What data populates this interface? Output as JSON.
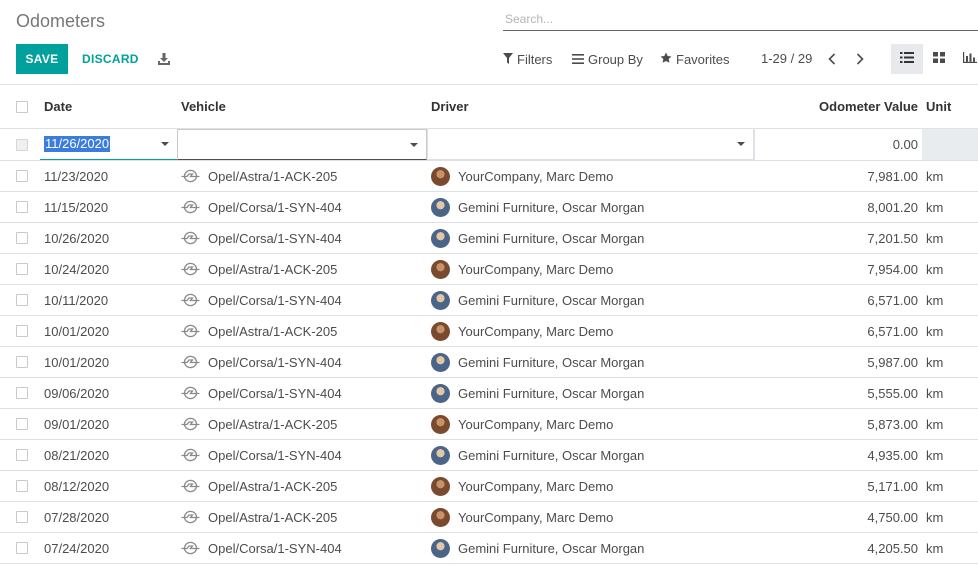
{
  "header": {
    "title": "Odometers",
    "search_placeholder": "Search..."
  },
  "toolbar": {
    "save_label": "SAVE",
    "discard_label": "DISCARD",
    "filters_label": "Filters",
    "groupby_label": "Group By",
    "favorites_label": "Favorites",
    "pager": "1-29 / 29"
  },
  "columns": {
    "date": "Date",
    "vehicle": "Vehicle",
    "driver": "Driver",
    "odometer": "Odometer Value",
    "unit": "Unit"
  },
  "edit_row": {
    "date": "11/26/2020",
    "vehicle": "",
    "driver": "",
    "odometer": "0.00"
  },
  "rows": [
    {
      "date": "11/23/2020",
      "vehicle": "Opel/Astra/1-ACK-205",
      "driver": "YourCompany, Marc Demo",
      "odometer": "7,981.00",
      "unit": "km",
      "avatar": "marc"
    },
    {
      "date": "11/15/2020",
      "vehicle": "Opel/Corsa/1-SYN-404",
      "driver": "Gemini Furniture, Oscar Morgan",
      "odometer": "8,001.20",
      "unit": "km",
      "avatar": "oscar"
    },
    {
      "date": "10/26/2020",
      "vehicle": "Opel/Corsa/1-SYN-404",
      "driver": "Gemini Furniture, Oscar Morgan",
      "odometer": "7,201.50",
      "unit": "km",
      "avatar": "oscar"
    },
    {
      "date": "10/24/2020",
      "vehicle": "Opel/Astra/1-ACK-205",
      "driver": "YourCompany, Marc Demo",
      "odometer": "7,954.00",
      "unit": "km",
      "avatar": "marc"
    },
    {
      "date": "10/11/2020",
      "vehicle": "Opel/Corsa/1-SYN-404",
      "driver": "Gemini Furniture, Oscar Morgan",
      "odometer": "6,571.00",
      "unit": "km",
      "avatar": "oscar"
    },
    {
      "date": "10/01/2020",
      "vehicle": "Opel/Astra/1-ACK-205",
      "driver": "YourCompany, Marc Demo",
      "odometer": "6,571.00",
      "unit": "km",
      "avatar": "marc"
    },
    {
      "date": "10/01/2020",
      "vehicle": "Opel/Corsa/1-SYN-404",
      "driver": "Gemini Furniture, Oscar Morgan",
      "odometer": "5,987.00",
      "unit": "km",
      "avatar": "oscar"
    },
    {
      "date": "09/06/2020",
      "vehicle": "Opel/Corsa/1-SYN-404",
      "driver": "Gemini Furniture, Oscar Morgan",
      "odometer": "5,555.00",
      "unit": "km",
      "avatar": "oscar"
    },
    {
      "date": "09/01/2020",
      "vehicle": "Opel/Astra/1-ACK-205",
      "driver": "YourCompany, Marc Demo",
      "odometer": "5,873.00",
      "unit": "km",
      "avatar": "marc"
    },
    {
      "date": "08/21/2020",
      "vehicle": "Opel/Corsa/1-SYN-404",
      "driver": "Gemini Furniture, Oscar Morgan",
      "odometer": "4,935.00",
      "unit": "km",
      "avatar": "oscar"
    },
    {
      "date": "08/12/2020",
      "vehicle": "Opel/Astra/1-ACK-205",
      "driver": "YourCompany, Marc Demo",
      "odometer": "5,171.00",
      "unit": "km",
      "avatar": "marc"
    },
    {
      "date": "07/28/2020",
      "vehicle": "Opel/Astra/1-ACK-205",
      "driver": "YourCompany, Marc Demo",
      "odometer": "4,750.00",
      "unit": "km",
      "avatar": "marc"
    },
    {
      "date": "07/24/2020",
      "vehicle": "Opel/Corsa/1-SYN-404",
      "driver": "Gemini Furniture, Oscar Morgan",
      "odometer": "4,205.50",
      "unit": "km",
      "avatar": "oscar"
    }
  ],
  "colors": {
    "accent": "#00a09d",
    "text": "#4c4c4c",
    "border": "#dee2e6"
  },
  "icons": {
    "download": "download-icon",
    "filters": "funnel-icon",
    "groupby": "bars-icon",
    "favorites": "star-icon",
    "vehicle": "car-brand-logo-icon"
  }
}
